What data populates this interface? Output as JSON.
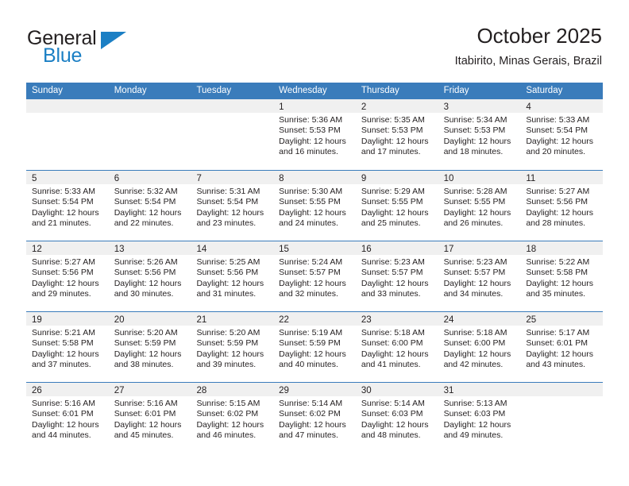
{
  "logo": {
    "word_one": "General",
    "word_two": "Blue",
    "triangle_icon": "triangle-icon",
    "accent_color": "#1b7fc4"
  },
  "header": {
    "title": "October 2025",
    "subtitle": "Itabirito, Minas Gerais, Brazil"
  },
  "theme": {
    "header_blue": "#3a7cbb",
    "day_head_gray": "#f0f0f0",
    "text_color": "#231f20"
  },
  "calendar": {
    "weekday_headers": [
      "Sunday",
      "Monday",
      "Tuesday",
      "Wednesday",
      "Thursday",
      "Friday",
      "Saturday"
    ],
    "weeks": [
      [
        {
          "day": "",
          "empty": true,
          "lines": []
        },
        {
          "day": "",
          "empty": true,
          "lines": []
        },
        {
          "day": "",
          "empty": true,
          "lines": []
        },
        {
          "day": "1",
          "empty": false,
          "lines": [
            "Sunrise: 5:36 AM",
            "Sunset: 5:53 PM",
            "Daylight: 12 hours",
            "and 16 minutes."
          ]
        },
        {
          "day": "2",
          "empty": false,
          "lines": [
            "Sunrise: 5:35 AM",
            "Sunset: 5:53 PM",
            "Daylight: 12 hours",
            "and 17 minutes."
          ]
        },
        {
          "day": "3",
          "empty": false,
          "lines": [
            "Sunrise: 5:34 AM",
            "Sunset: 5:53 PM",
            "Daylight: 12 hours",
            "and 18 minutes."
          ]
        },
        {
          "day": "4",
          "empty": false,
          "lines": [
            "Sunrise: 5:33 AM",
            "Sunset: 5:54 PM",
            "Daylight: 12 hours",
            "and 20 minutes."
          ]
        }
      ],
      [
        {
          "day": "5",
          "empty": false,
          "lines": [
            "Sunrise: 5:33 AM",
            "Sunset: 5:54 PM",
            "Daylight: 12 hours",
            "and 21 minutes."
          ]
        },
        {
          "day": "6",
          "empty": false,
          "lines": [
            "Sunrise: 5:32 AM",
            "Sunset: 5:54 PM",
            "Daylight: 12 hours",
            "and 22 minutes."
          ]
        },
        {
          "day": "7",
          "empty": false,
          "lines": [
            "Sunrise: 5:31 AM",
            "Sunset: 5:54 PM",
            "Daylight: 12 hours",
            "and 23 minutes."
          ]
        },
        {
          "day": "8",
          "empty": false,
          "lines": [
            "Sunrise: 5:30 AM",
            "Sunset: 5:55 PM",
            "Daylight: 12 hours",
            "and 24 minutes."
          ]
        },
        {
          "day": "9",
          "empty": false,
          "lines": [
            "Sunrise: 5:29 AM",
            "Sunset: 5:55 PM",
            "Daylight: 12 hours",
            "and 25 minutes."
          ]
        },
        {
          "day": "10",
          "empty": false,
          "lines": [
            "Sunrise: 5:28 AM",
            "Sunset: 5:55 PM",
            "Daylight: 12 hours",
            "and 26 minutes."
          ]
        },
        {
          "day": "11",
          "empty": false,
          "lines": [
            "Sunrise: 5:27 AM",
            "Sunset: 5:56 PM",
            "Daylight: 12 hours",
            "and 28 minutes."
          ]
        }
      ],
      [
        {
          "day": "12",
          "empty": false,
          "lines": [
            "Sunrise: 5:27 AM",
            "Sunset: 5:56 PM",
            "Daylight: 12 hours",
            "and 29 minutes."
          ]
        },
        {
          "day": "13",
          "empty": false,
          "lines": [
            "Sunrise: 5:26 AM",
            "Sunset: 5:56 PM",
            "Daylight: 12 hours",
            "and 30 minutes."
          ]
        },
        {
          "day": "14",
          "empty": false,
          "lines": [
            "Sunrise: 5:25 AM",
            "Sunset: 5:56 PM",
            "Daylight: 12 hours",
            "and 31 minutes."
          ]
        },
        {
          "day": "15",
          "empty": false,
          "lines": [
            "Sunrise: 5:24 AM",
            "Sunset: 5:57 PM",
            "Daylight: 12 hours",
            "and 32 minutes."
          ]
        },
        {
          "day": "16",
          "empty": false,
          "lines": [
            "Sunrise: 5:23 AM",
            "Sunset: 5:57 PM",
            "Daylight: 12 hours",
            "and 33 minutes."
          ]
        },
        {
          "day": "17",
          "empty": false,
          "lines": [
            "Sunrise: 5:23 AM",
            "Sunset: 5:57 PM",
            "Daylight: 12 hours",
            "and 34 minutes."
          ]
        },
        {
          "day": "18",
          "empty": false,
          "lines": [
            "Sunrise: 5:22 AM",
            "Sunset: 5:58 PM",
            "Daylight: 12 hours",
            "and 35 minutes."
          ]
        }
      ],
      [
        {
          "day": "19",
          "empty": false,
          "lines": [
            "Sunrise: 5:21 AM",
            "Sunset: 5:58 PM",
            "Daylight: 12 hours",
            "and 37 minutes."
          ]
        },
        {
          "day": "20",
          "empty": false,
          "lines": [
            "Sunrise: 5:20 AM",
            "Sunset: 5:59 PM",
            "Daylight: 12 hours",
            "and 38 minutes."
          ]
        },
        {
          "day": "21",
          "empty": false,
          "lines": [
            "Sunrise: 5:20 AM",
            "Sunset: 5:59 PM",
            "Daylight: 12 hours",
            "and 39 minutes."
          ]
        },
        {
          "day": "22",
          "empty": false,
          "lines": [
            "Sunrise: 5:19 AM",
            "Sunset: 5:59 PM",
            "Daylight: 12 hours",
            "and 40 minutes."
          ]
        },
        {
          "day": "23",
          "empty": false,
          "lines": [
            "Sunrise: 5:18 AM",
            "Sunset: 6:00 PM",
            "Daylight: 12 hours",
            "and 41 minutes."
          ]
        },
        {
          "day": "24",
          "empty": false,
          "lines": [
            "Sunrise: 5:18 AM",
            "Sunset: 6:00 PM",
            "Daylight: 12 hours",
            "and 42 minutes."
          ]
        },
        {
          "day": "25",
          "empty": false,
          "lines": [
            "Sunrise: 5:17 AM",
            "Sunset: 6:01 PM",
            "Daylight: 12 hours",
            "and 43 minutes."
          ]
        }
      ],
      [
        {
          "day": "26",
          "empty": false,
          "lines": [
            "Sunrise: 5:16 AM",
            "Sunset: 6:01 PM",
            "Daylight: 12 hours",
            "and 44 minutes."
          ]
        },
        {
          "day": "27",
          "empty": false,
          "lines": [
            "Sunrise: 5:16 AM",
            "Sunset: 6:01 PM",
            "Daylight: 12 hours",
            "and 45 minutes."
          ]
        },
        {
          "day": "28",
          "empty": false,
          "lines": [
            "Sunrise: 5:15 AM",
            "Sunset: 6:02 PM",
            "Daylight: 12 hours",
            "and 46 minutes."
          ]
        },
        {
          "day": "29",
          "empty": false,
          "lines": [
            "Sunrise: 5:14 AM",
            "Sunset: 6:02 PM",
            "Daylight: 12 hours",
            "and 47 minutes."
          ]
        },
        {
          "day": "30",
          "empty": false,
          "lines": [
            "Sunrise: 5:14 AM",
            "Sunset: 6:03 PM",
            "Daylight: 12 hours",
            "and 48 minutes."
          ]
        },
        {
          "day": "31",
          "empty": false,
          "lines": [
            "Sunrise: 5:13 AM",
            "Sunset: 6:03 PM",
            "Daylight: 12 hours",
            "and 49 minutes."
          ]
        },
        {
          "day": "",
          "empty": true,
          "lines": []
        }
      ]
    ]
  }
}
